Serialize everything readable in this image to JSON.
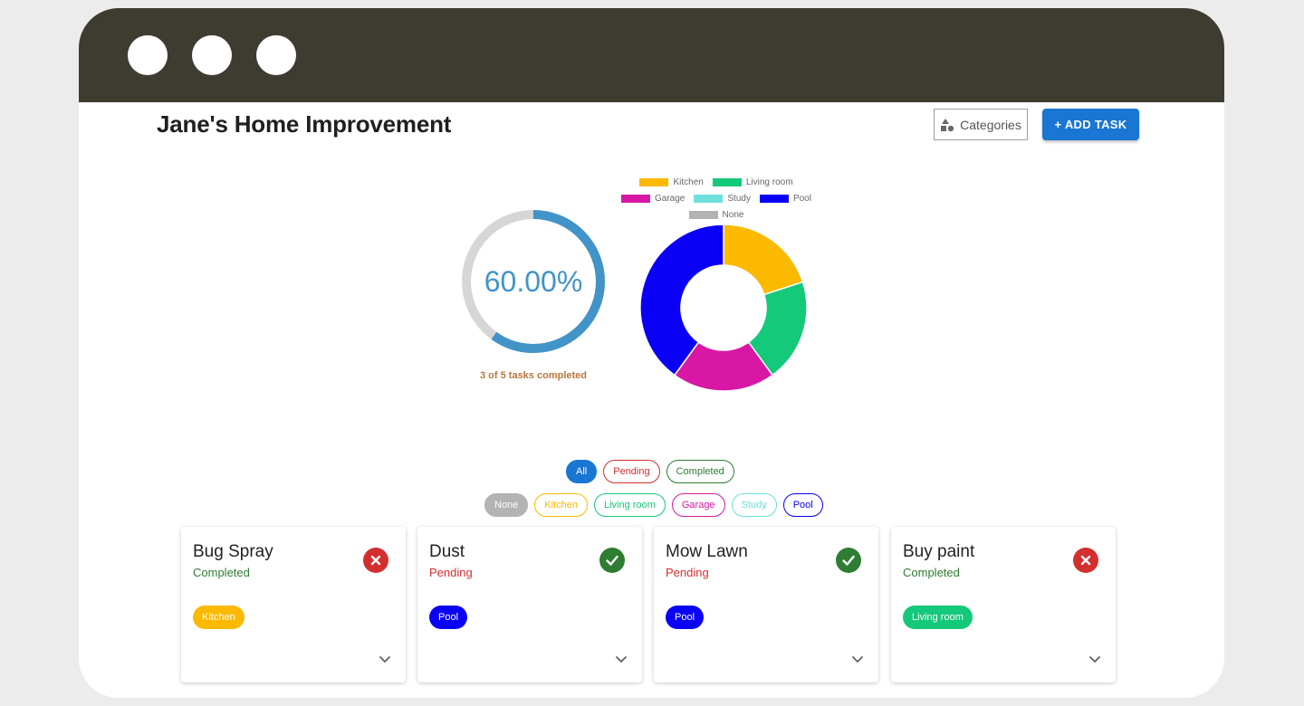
{
  "app": {
    "title": "Jane's Home Improvement",
    "categories_button": "Categories",
    "add_task_button": "+ ADD TASK"
  },
  "progress": {
    "percent_label": "60.00%",
    "fraction": 0.6,
    "caption": "3 of 5 tasks completed",
    "color": "#4294c8",
    "track_color": "#d6d6d6"
  },
  "chart_data": {
    "type": "pie",
    "donut": true,
    "legend_position": "top",
    "categories": [
      "Kitchen",
      "Living room",
      "Garage",
      "Study",
      "Pool",
      "None"
    ],
    "values": [
      1,
      1,
      1,
      0,
      2,
      0
    ],
    "colors": [
      "#fbb900",
      "#14c97a",
      "#d818a4",
      "#6fe0de",
      "#0b00f6",
      "#b3b3b3"
    ]
  },
  "filters": {
    "status": [
      {
        "label": "All",
        "active": true,
        "color": "#1976d2"
      },
      {
        "label": "Pending",
        "active": false,
        "color": "#d32f2f"
      },
      {
        "label": "Completed",
        "active": false,
        "color": "#2e7d32"
      }
    ],
    "categories": [
      {
        "label": "None",
        "active": true,
        "color": "#b3b3b3"
      },
      {
        "label": "Kitchen",
        "active": false,
        "color": "#fbb900"
      },
      {
        "label": "Living room",
        "active": false,
        "color": "#14c97a"
      },
      {
        "label": "Garage",
        "active": false,
        "color": "#d818a4"
      },
      {
        "label": "Study",
        "active": false,
        "color": "#6fe0de"
      },
      {
        "label": "Pool",
        "active": false,
        "color": "#0b00f6"
      }
    ]
  },
  "tasks": [
    {
      "title": "Bug Spray",
      "status": "Completed",
      "status_color": "#2e7d32",
      "action_icon": "close-circle-icon",
      "action_color": "#d32f2f",
      "tag": "Kitchen",
      "tag_color": "#fbb900"
    },
    {
      "title": "Dust",
      "status": "Pending",
      "status_color": "#d32f2f",
      "action_icon": "check-circle-icon",
      "action_color": "#2e7d32",
      "tag": "Pool",
      "tag_color": "#0b00f6"
    },
    {
      "title": "Mow Lawn",
      "status": "Pending",
      "status_color": "#d32f2f",
      "action_icon": "check-circle-icon",
      "action_color": "#2e7d32",
      "tag": "Pool",
      "tag_color": "#0b00f6"
    },
    {
      "title": "Buy paint",
      "status": "Completed",
      "status_color": "#2e7d32",
      "action_icon": "close-circle-icon",
      "action_color": "#d32f2f",
      "tag": "Living room",
      "tag_color": "#14c97a"
    }
  ]
}
